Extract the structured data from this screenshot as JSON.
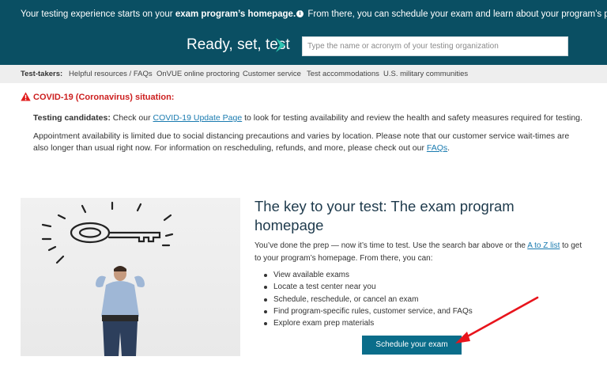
{
  "hero": {
    "intro_prefix": "Your testing experience starts on your ",
    "intro_bold": "exam program’s homepage.",
    "info_icon": "info-icon",
    "intro_suffix": " From there, you can schedule your exam and learn about your program’s policies.",
    "ready_label": "Ready, set, test",
    "arrow_icon": "chevron-right-icon",
    "search_placeholder": "Type the name or acronym of your testing organization",
    "search_value": ""
  },
  "subnav": {
    "label": "Test-takers:",
    "items": [
      "Helpful resources / FAQs",
      "OnVUE online proctoring",
      "Customer service",
      "Test accommodations",
      "U.S. military communities"
    ]
  },
  "covid": {
    "warning_icon": "warning-triangle-icon",
    "title": "COVID-19 (Coronavirus) situation:",
    "p1_bold": "Testing candidates:",
    "p1_before_link": " Check our ",
    "p1_link": "COVID-19 Update Page",
    "p1_after_link": " to look for testing availability and review the health and safety measures required for testing.",
    "p2_text": "Appointment availability is limited due to social distancing precautions and varies by location. Please note that our customer service wait-times are also longer than usual right now. For information on rescheduling, refunds, and more, please check out our ",
    "p2_link": "FAQs",
    "p2_end": "."
  },
  "feature": {
    "image": "key-illustration-person-photo",
    "title": "The key to your test: The exam program homepage",
    "intro_before_link": "You’ve done the prep — now it’s time to test. Use the search bar above or the ",
    "intro_link": "A to Z list",
    "intro_after_link": " to get to your program’s homepage. From there, you can:",
    "bullets": [
      "View available exams",
      "Locate a test center near you",
      "Schedule, reschedule, or cancel an exam",
      "Find program-specific rules, customer service, and FAQs",
      "Explore exam prep materials"
    ],
    "cta_label": "Schedule your exam"
  },
  "colors": {
    "hero_bg": "#0a4f63",
    "cta_bg": "#0a6d8a",
    "link": "#1a7bb0",
    "warning": "#cc1f1f",
    "annotation_arrow": "#e8141c"
  }
}
